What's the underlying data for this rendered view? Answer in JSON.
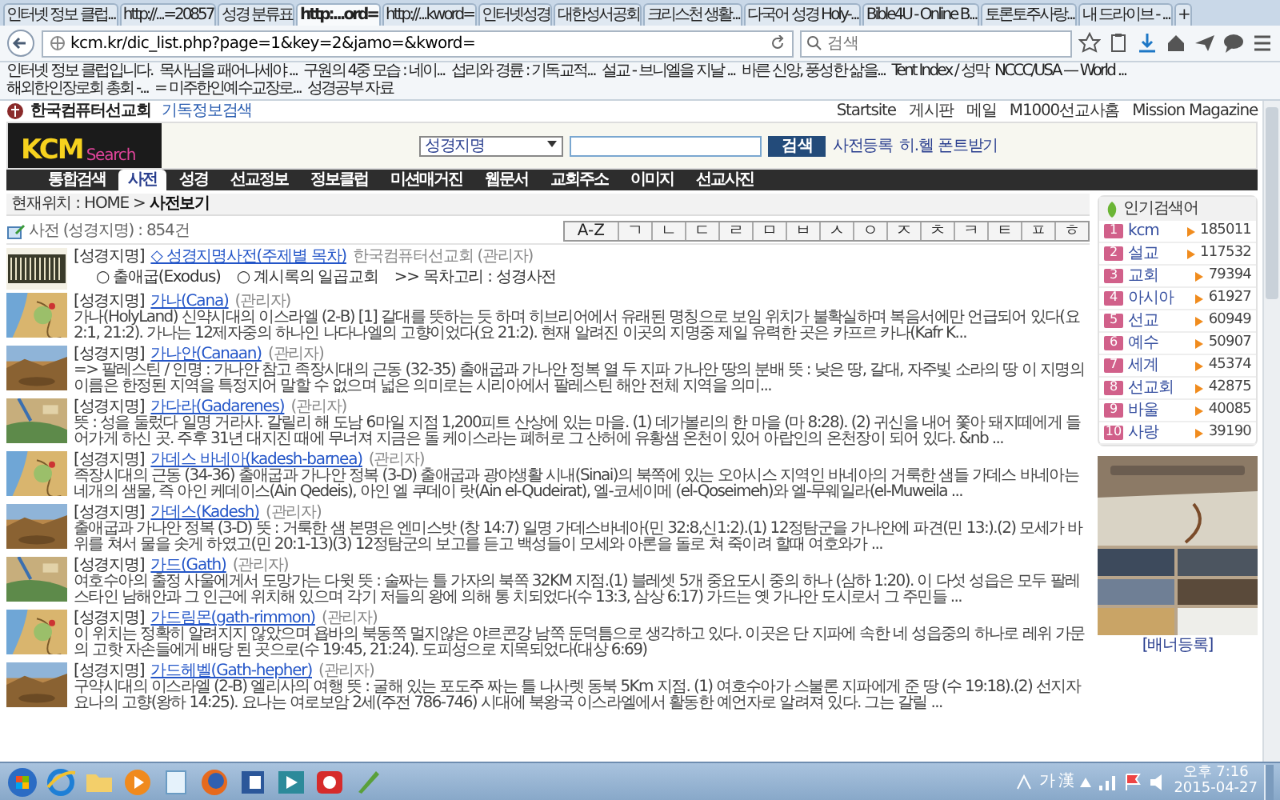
{
  "browser": {
    "tabs": [
      {
        "label": "인터넷 정보 클럽...",
        "selected": false
      },
      {
        "label": "http://...=20857",
        "selected": false
      },
      {
        "label": "성경 분류표",
        "selected": false
      },
      {
        "label": "http:...ord=",
        "selected": true
      },
      {
        "label": "http://...kword=",
        "selected": false
      },
      {
        "label": "인터넷성경",
        "selected": false
      },
      {
        "label": "대한성서공회",
        "selected": false
      },
      {
        "label": "크리스천 생활...",
        "selected": false
      },
      {
        "label": "다국어 성경 Holy-...",
        "selected": false
      },
      {
        "label": "Bible4U - Online B...",
        "selected": false
      },
      {
        "label": "토론토주사랑...",
        "selected": false
      },
      {
        "label": "내 드라이브 - ...",
        "selected": false
      }
    ],
    "new_tab": "+",
    "address": "kcm.kr/dic_list.php?page=1&key=2&jamo=&kword=",
    "search": {
      "placeholder": "검색"
    },
    "bookmarks": [
      "인터넷 정보 클럽입니다.",
      "목사님을 패어나세야 ...",
      "구원의 4중 모습 : 네이...",
      "섭리와 경륜 : 기독교적...",
      "설교 - 브니엘을 지날 ...",
      "바른 신앙, 풍성한 삶을...",
      "Tent Index / 성막",
      "NCCC/USA — World ...",
      "해외한인장로회 총회 -...",
      "= 미주한인예수교장로...",
      "성경공부 자료"
    ]
  },
  "site": {
    "org": "한국컴퓨터선교회",
    "org_sub": "기독정보검색",
    "top_links": [
      "Startsite",
      "게시판",
      "메일",
      "M1000선교사홈",
      "Mission Magazine"
    ],
    "logo": {
      "main": "KCM",
      "sub": "Search"
    },
    "search": {
      "scope": "성경지명",
      "button": "검색",
      "links": [
        "사전등록",
        "히.헬 폰트받기"
      ]
    },
    "menu": [
      {
        "label": "통합검색",
        "selected": false
      },
      {
        "label": "사전",
        "selected": true
      },
      {
        "label": "성경",
        "selected": false
      },
      {
        "label": "선교정보",
        "selected": false
      },
      {
        "label": "정보클럽",
        "selected": false
      },
      {
        "label": "미션매거진",
        "selected": false
      },
      {
        "label": "웹문서",
        "selected": false
      },
      {
        "label": "교회주소",
        "selected": false
      },
      {
        "label": "이미지",
        "selected": false
      },
      {
        "label": "선교사진",
        "selected": false
      }
    ]
  },
  "breadcrumb": "현재위치 : HOME > **사전보기**",
  "count": "사전 (성경지명) : 854건",
  "index_letters": [
    "A-Z",
    "ㄱ",
    "ㄴ",
    "ㄷ",
    "ㄹ",
    "ㅁ",
    "ㅂ",
    "ㅅ",
    "ㅇ",
    "ㅈ",
    "ㅊ",
    "ㅋ",
    "ㅌ",
    "ㅍ",
    "ㅎ"
  ],
  "intro": {
    "category": "[성경지명]",
    "title": "◇ 성경지명사전(주제별 목차)",
    "author": "한국컴퓨터선교회 (관리자)",
    "links": [
      "○ 출애굽(Exodus)",
      "○ 계시록의 일곱교회",
      ">> 목차고리 : 성경사전"
    ]
  },
  "entries": [
    {
      "category": "[성경지명]",
      "title": "가나(Cana)",
      "author": "(관리자)",
      "text": "가나(HolyLand) 신약시대의 이스라엘 (2-B)   [1] 갈대를 뜻하는 듯 하며 히브리어에서 유래된 명칭으로 보임 위치가 불확실하며 복음서에만 언급되어 있다(요 2:1, 21:2). 가나는 12제자중의 하나인 나다나엘의 고향이었다(요 21:2). 현재 알려진 이곳의 지명중 제일 유력한 곳은 카프르 카나(Kafr K..."
    },
    {
      "category": "[성경지명]",
      "title": "가나안(Canaan)",
      "author": "(관리자)",
      "text": "=> 팔레스틴 / 인명 : 가나안 참고   족장시대의 근동 (32-35) 출애굽과 가나안 정복 열 두 지파 가나안 땅의 분배  뜻 : 낮은 땅, 갈대, 자주빛 소라의 땅   이 지명의 이름은 한정된 지역을 특정지어 말할 수 없으며 넓은 의미로는 시리아에서 팔레스틴 해안 전체 지역을 의미..."
    },
    {
      "category": "[성경지명]",
      "title": "가다라(Gadarenes)",
      "author": "(관리자)",
      "text": "뜻 : 성을 둘렀다   일명 거라사. 갈릴리 해 도남 6마일 지점 1,200피트 산상에 있는 마을. (1) 데가볼리의 한 마을 (마 8:28). (2) 귀신을 내어 쫓아 돼지떼에게 들어가게 하신 곳. 주후 31년 대지진 때에 무너져 지금은 돌 케이스라는 폐허로 그 산허에 유황샘 온천이 있어 아랍인의 온천장이 되어 있다. &nb ..."
    },
    {
      "category": "[성경지명]",
      "title": "가데스 바네아(kadesh-barnea)",
      "author": "(관리자)",
      "text": "족장시대의 근동 (34-36) 출애굽과 가나안 정복 (3-D) 출애굽과 광야생활   시내(Sinai)의 북쪽에 있는 오아시스 지역인 바네아의 거룩한 샘들 가데스 바네아는 네개의 샘물, 즉 아인 케데이스(Ain Qedeis), 아인 엘 쿠데이 랏(Ain el-Qudeirat), 엘-코세이메 (el-Qoseimeh)와 엘-무웨일라(el-Muweila ..."
    },
    {
      "category": "[성경지명]",
      "title": "가데스(Kadesh)",
      "author": "(관리자)",
      "text": "출애굽과 가나안 정복 (3-D)    뜻 : 거룩한 샘   본명은 엔미스밧 (창 14:7) 일명 가데스바네아(민 32:8,신1:2).(1) 12정탐군을 가나안에 파견(민 13:).(2) 모세가 바위를 쳐서 물을 솟게 하였고(민 20:1-13)(3) 12정탐군의 보고를 듣고 백성들이 모세와 아론을 돌로 쳐 죽이려 할때 여호와가 ..."
    },
    {
      "category": "[성경지명]",
      "title": "가드(Gath)",
      "author": "(관리자)",
      "text": "여호수아의 출정 사울에게서 도망가는 다윗 뜻 : 술짜는 틀   가자의 북쪽 32KM 지점.(1) 블레셋 5개 중요도시 중의 하나 (삼하 1:20). 이 다섯 성읍은 모두 팔레스타인 남해안과 그 인근에 위치해 있으며 각기 저들의 왕에 의해 통 치되었다(수 13:3, 삼상 6:17) 가드는 옛 가나안 도시로서 그 주민들 ..."
    },
    {
      "category": "[성경지명]",
      "title": "가드림몬(gath-rimmon)",
      "author": "(관리자)",
      "text": "이 위치는 정확히 알려지지 않았으며 욥바의 북동쪽 멀지않은 야르콘강 남쪽 둔덕틈으로 생각하고 있다. 이곳은 단 지파에 속한 네 성읍중의 하나로 레위 가문의 고핫 자손들에게 배당 된 곳으로(수 19:45, 21:24). 도피성으로 지목되었다(대상 6:69)"
    },
    {
      "category": "[성경지명]",
      "title": "가드헤벨(Gath-hepher)",
      "author": "(관리자)",
      "text": "구약시대의 이스라엘 (2-B) 엘리사의 여행 뜻 : 굴해 있는 포도주 짜는 틀   나사렛 동북 5Km 지점. (1) 여호수아가 스불론 지파에게 준 땅 (수 19:18).(2) 선지자 요나의 고향(왕하 14:25). 요나는 여로보암 2세(주전 786-746) 시대에 북왕국 이스라엘에서 활동한 예언자로 알려져 있다. 그는 갈릴 ..."
    }
  ],
  "popular": {
    "title": "인기검색어",
    "items": [
      {
        "rank": "1",
        "term": "kcm",
        "count": "185011"
      },
      {
        "rank": "2",
        "term": "설교",
        "count": "117532"
      },
      {
        "rank": "3",
        "term": "교회",
        "count": "79394"
      },
      {
        "rank": "4",
        "term": "아시아",
        "count": "61927"
      },
      {
        "rank": "5",
        "term": "선교",
        "count": "60949"
      },
      {
        "rank": "6",
        "term": "예수",
        "count": "50907"
      },
      {
        "rank": "7",
        "term": "세계",
        "count": "45374"
      },
      {
        "rank": "8",
        "term": "선교회",
        "count": "42875"
      },
      {
        "rank": "9",
        "term": "바울",
        "count": "40085"
      },
      {
        "rank": "10",
        "term": "사랑",
        "count": "39190"
      }
    ]
  },
  "banner_link": "[배너등록]",
  "taskbar": {
    "ime": "가 漢",
    "time": "오후 7:16",
    "date": "2015-04-27"
  }
}
